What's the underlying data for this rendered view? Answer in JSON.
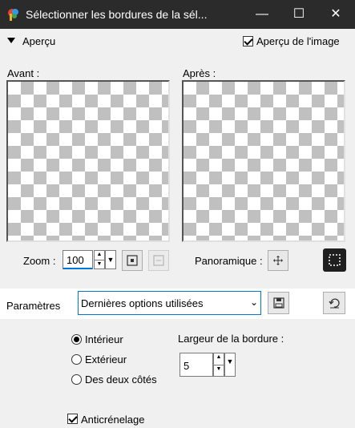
{
  "window": {
    "title": "Sélectionner les bordures de la sél...",
    "minimize_glyph": "—",
    "maximize_glyph": "☐",
    "close_glyph": "✕"
  },
  "preview": {
    "section_label": "Aperçu",
    "image_preview_label": "Aperçu de l'image",
    "image_preview_checked": true,
    "before_label": "Avant :",
    "after_label": "Après :"
  },
  "zoom": {
    "label": "Zoom :",
    "value": "100",
    "pan_label": "Panoramique :"
  },
  "params": {
    "label": "Paramètres",
    "preset_value": "Dernières options utilisées"
  },
  "options": {
    "radios": [
      {
        "label": "Intérieur",
        "selected": true
      },
      {
        "label": "Extérieur",
        "selected": false
      },
      {
        "label": "Des deux côtés",
        "selected": false
      }
    ],
    "border_width_label": "Largeur de la bordure :",
    "border_width_value": "5",
    "antialias_label": "Anticrénelage",
    "antialias_checked": true
  },
  "colors": {
    "titlebar": "#2b2b2b",
    "focus_underline": "#0078d7"
  }
}
